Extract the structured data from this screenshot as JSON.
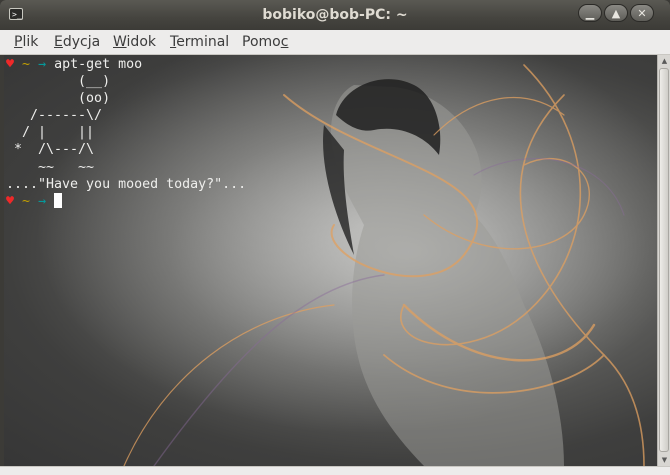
{
  "window": {
    "title": "bobiko@bob-PC: ~",
    "icon": "terminal-icon",
    "buttons": {
      "minimize": "minimize-icon",
      "maximize": "maximize-icon",
      "close": "close-icon"
    }
  },
  "menu": [
    {
      "pre": "",
      "acc": "P",
      "post": "lik"
    },
    {
      "pre": "",
      "acc": "E",
      "post": "dycja"
    },
    {
      "pre": "",
      "acc": "W",
      "post": "idok"
    },
    {
      "pre": "",
      "acc": "T",
      "post": "erminal"
    },
    {
      "pre": "Pomo",
      "acc": "c",
      "post": ""
    }
  ],
  "terminal": {
    "prompt": {
      "heart": "♥",
      "tilde": "~",
      "arrow": "→"
    },
    "command": "apt-get moo",
    "output": [
      "         (__)",
      "         (oo)",
      "   /------\\/",
      "  / |    ||",
      " *  /\\---/\\",
      "    ~~   ~~",
      "....\"Have you mooed today?\"..."
    ]
  },
  "colors": {
    "prompt_heart": "#ef2929",
    "prompt_tilde": "#c4a000",
    "prompt_arrow": "#06989a",
    "text": "#eeeeec",
    "titlebar": "#3c3b37",
    "menubar": "#edeceb"
  }
}
